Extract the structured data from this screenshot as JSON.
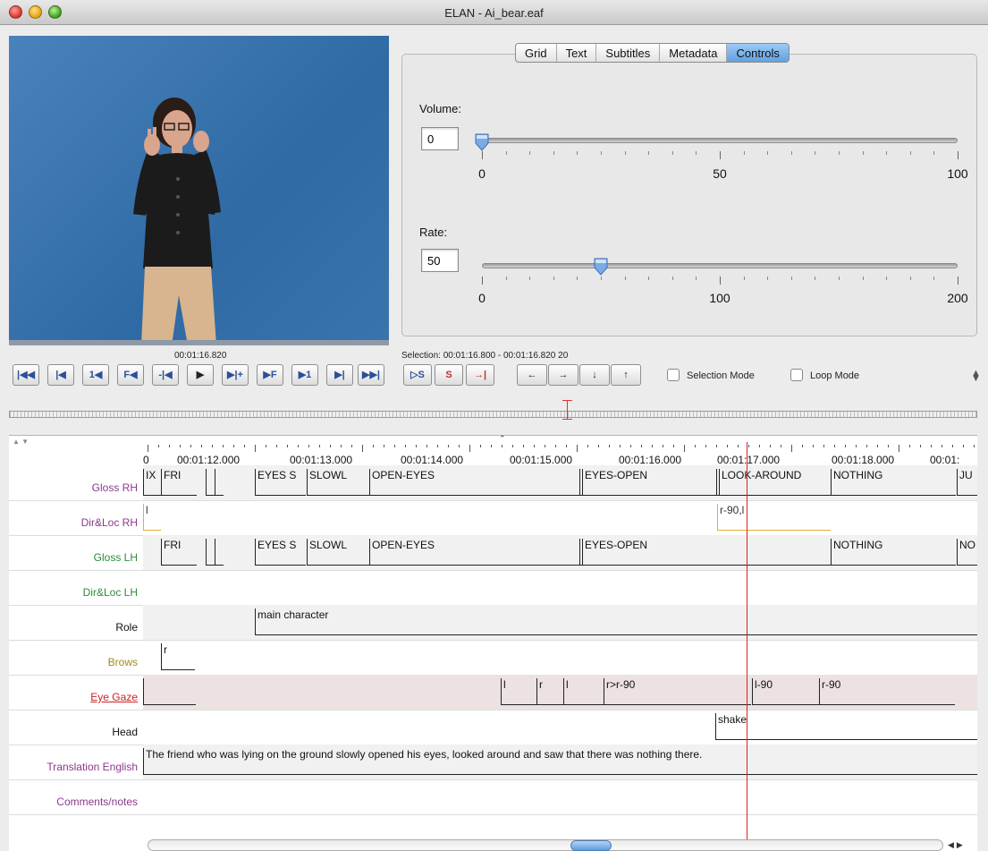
{
  "window": {
    "title": "ELAN - Ai_bear.eaf"
  },
  "media": {
    "time": "00:01:16.820",
    "selection": "Selection: 00:01:16.800 - 00:01:16.820  20"
  },
  "tabs": [
    "Grid",
    "Text",
    "Subtitles",
    "Metadata",
    "Controls"
  ],
  "active_tab": "Controls",
  "controls": {
    "volume": {
      "label": "Volume:",
      "value": "0",
      "ticks": [
        "0",
        "50",
        "100"
      ],
      "level": 0
    },
    "rate": {
      "label": "Rate:",
      "value": "50",
      "ticks": [
        "0",
        "100",
        "200"
      ],
      "level": 50
    }
  },
  "player_buttons": [
    "|◀◀",
    "|◀",
    "1◀",
    "F◀",
    "-|◀",
    "▶",
    "▶|+",
    "▶F",
    "▶1",
    "▶|",
    "▶▶|"
  ],
  "selection_buttons": [
    "▷S",
    "S",
    "→|"
  ],
  "nav_buttons": [
    "←",
    "→",
    "↓",
    "↑"
  ],
  "checkboxes": {
    "selection_mode": "Selection Mode",
    "loop_mode": "Loop Mode"
  },
  "ruler": {
    "labels": [
      "0",
      "00:01:12.000",
      "00:01:13.000",
      "00:01:14.000",
      "00:01:15.000",
      "00:01:16.000",
      "00:01:17.000",
      "00:01:18.000",
      "00:01:"
    ]
  },
  "tiers": [
    {
      "name": "Gloss RH",
      "color": "#8a3a8a",
      "annotations": [
        "IX",
        "FRI",
        "",
        "",
        "EYES S",
        "SLOWL",
        "OPEN-EYES",
        "",
        "EYES-OPEN",
        "",
        "LOOK-AROUND",
        "NOTHING",
        "JU"
      ]
    },
    {
      "name": "Dir&Loc RH",
      "color": "#8a3a8a",
      "annotations": [
        "l",
        "r-90,l"
      ]
    },
    {
      "name": "Gloss LH",
      "color": "#2e8b3a",
      "annotations": [
        "FRI",
        "",
        "",
        "EYES S",
        "SLOWL",
        "OPEN-EYES",
        "",
        "EYES-OPEN",
        "NOTHING",
        "NO"
      ]
    },
    {
      "name": "Dir&Loc LH",
      "color": "#2e8b3a",
      "annotations": []
    },
    {
      "name": "Role",
      "color": "#111111",
      "annotations": [
        "main character"
      ]
    },
    {
      "name": "Brows",
      "color": "#a08a1a",
      "annotations": [
        "r"
      ]
    },
    {
      "name": "Eye Gaze",
      "color": "#cc2222",
      "annotations": [
        "",
        "l",
        "r",
        "l",
        "r>r-90",
        "l-90",
        "r-90"
      ]
    },
    {
      "name": "Head",
      "color": "#111111",
      "annotations": [
        "shake"
      ]
    },
    {
      "name": "Translation English",
      "color": "#8a3a8a",
      "annotations": [
        "The friend who was lying on the ground slowly opened his eyes, looked around and saw that there was nothing there."
      ]
    },
    {
      "name": "Comments/notes",
      "color": "#8a3a8a",
      "annotations": []
    }
  ]
}
